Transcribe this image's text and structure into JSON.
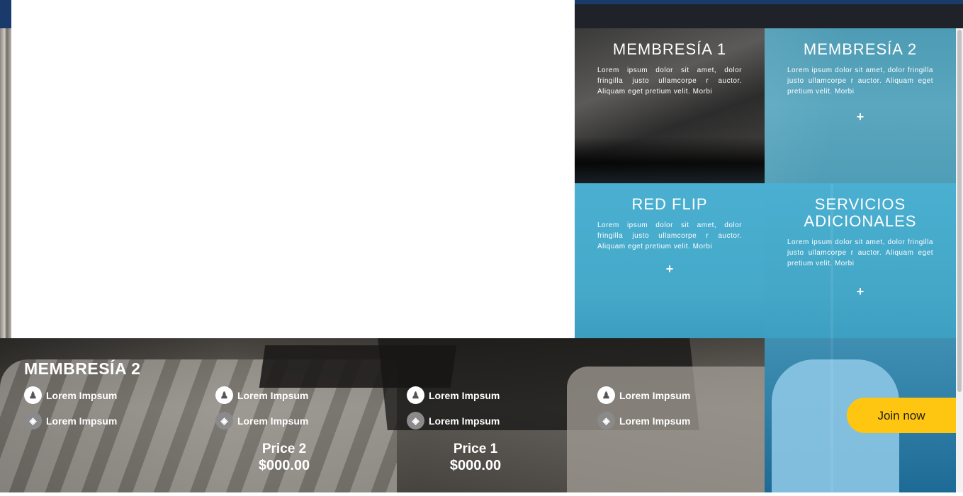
{
  "tiles": [
    {
      "title": "MEMBRESÍA 1",
      "text": "Lorem ipsum dolor sit amet, dolor fringilla justo ullamcorpe r auctor. Aliquam eget pretium velit. Morbi",
      "action": ""
    },
    {
      "title": "MEMBRESÍA 2",
      "text": "Lorem ipsum dolor sit amet, dolor fringilla justo ullamcorpe r auctor. Aliquam eget pretium velit. Morbi",
      "action": "+"
    },
    {
      "title": "RED FLIP",
      "text": "Lorem ipsum dolor sit amet, dolor fringilla justo ullamcorpe r auctor. Aliquam eget pretium velit. Morbi",
      "action": "+"
    },
    {
      "title": "SERVICIOS ADICIONALES",
      "text": "Lorem ipsum dolor sit amet, dolor fringilla justo ullamcorpe r auctor. Aliquam eget pretium velit. Morbi",
      "action": "+"
    }
  ],
  "membership": {
    "title": "MEMBRESÍA 2",
    "features": [
      {
        "icon": "group-icon",
        "label": "Lorem Impsum"
      },
      {
        "icon": "group-icon",
        "label": "Lorem Impsum"
      },
      {
        "icon": "group-icon",
        "label": "Lorem Impsum"
      },
      {
        "icon": "group-icon",
        "label": "Lorem Impsum"
      },
      {
        "icon": "gamepad-icon",
        "label": "Lorem Impsum"
      },
      {
        "icon": "gamepad-icon",
        "label": "Lorem Impsum"
      },
      {
        "icon": "gamepad-icon",
        "label": "Lorem Impsum"
      },
      {
        "icon": "gamepad-icon",
        "label": "Lorem Impsum"
      }
    ],
    "prices": [
      {
        "label": "Price 2",
        "value": "$000.00"
      },
      {
        "label": "Price 1",
        "value": "$000.00"
      }
    ]
  },
  "cta": {
    "label": "Join now",
    "color": "#ffc611"
  },
  "colors": {
    "tile_blue": "#4aafd0",
    "nav": "#1f2329"
  }
}
